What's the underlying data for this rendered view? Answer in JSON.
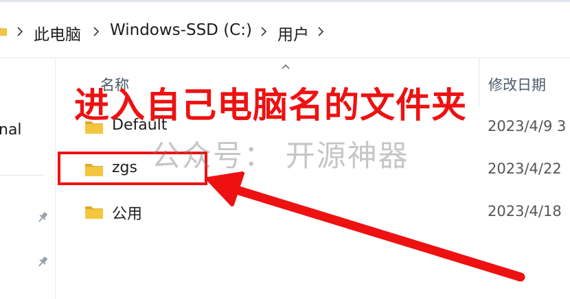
{
  "breadcrumb": {
    "items": [
      "此电脑",
      "Windows-SSD (C:)",
      "用户"
    ]
  },
  "nav": {
    "partial_label": "nal"
  },
  "columns": {
    "name": "名称",
    "date_modified": "修改日期"
  },
  "files": [
    {
      "name": "Default",
      "date": "2023/4/9 3"
    },
    {
      "name": "zgs",
      "date": "2023/4/22"
    },
    {
      "name": "公用",
      "date": "2023/4/18"
    }
  ],
  "annotation": {
    "title": "进入自己电脑名的文件夹",
    "watermark": "公众号：  开源神器",
    "color": "#ee1111"
  },
  "colors": {
    "folder": "#f4c53f",
    "folder_dark": "#e0a92a"
  }
}
